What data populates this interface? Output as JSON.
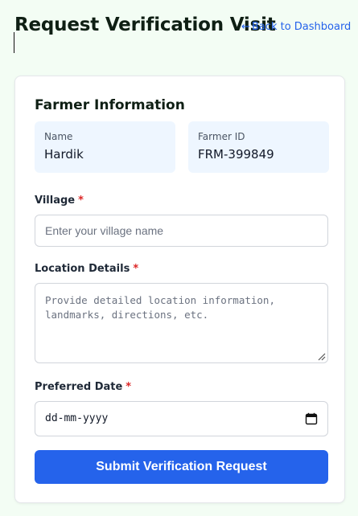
{
  "header": {
    "title": "Request Verification Visit",
    "back_link": "Back to Dashboard",
    "back_arrow": "←"
  },
  "farmer_info": {
    "title": "Farmer Information",
    "name_label": "Name",
    "name_value": "Hardik",
    "id_label": "Farmer ID",
    "id_value": "FRM-399849"
  },
  "form": {
    "village_label": "Village",
    "village_placeholder": "Enter your village name",
    "village_value": "",
    "location_label": "Location Details",
    "location_placeholder": "Provide detailed location information, landmarks, directions, etc.",
    "location_value": "",
    "date_label": "Preferred Date",
    "date_placeholder": "dd-mm-yyyy",
    "required_marker": "*",
    "submit_label": "Submit Verification Request"
  },
  "icons": {
    "back": "left-arrow-icon",
    "calendar": "calendar-icon",
    "resize": "resize-grip-icon"
  },
  "colors": {
    "background": "#f3fdf4",
    "accent": "#2563eb",
    "required": "#dc2626",
    "info_box": "#eef6ff"
  }
}
